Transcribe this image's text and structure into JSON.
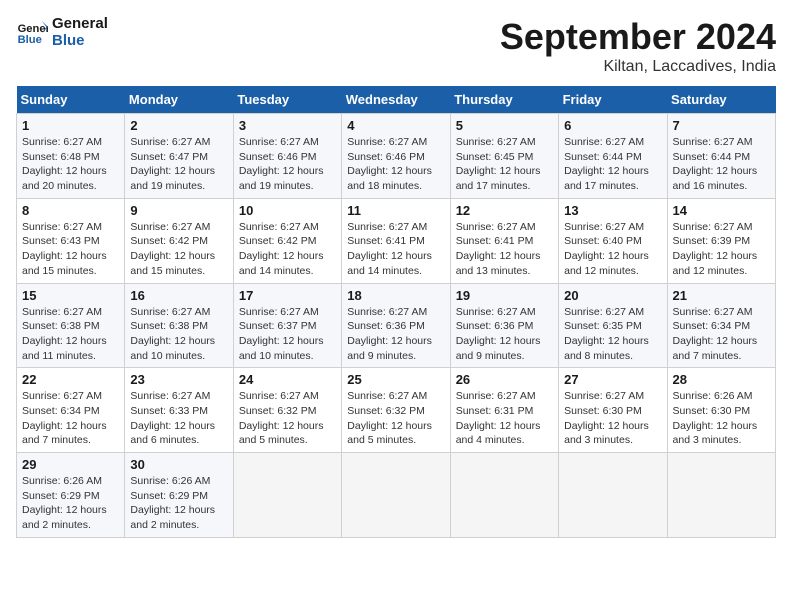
{
  "logo": {
    "line1": "General",
    "line2": "Blue"
  },
  "title": "September 2024",
  "subtitle": "Kiltan, Laccadives, India",
  "days_of_week": [
    "Sunday",
    "Monday",
    "Tuesday",
    "Wednesday",
    "Thursday",
    "Friday",
    "Saturday"
  ],
  "weeks": [
    [
      {
        "day": "1",
        "sunrise": "6:27 AM",
        "sunset": "6:48 PM",
        "daylight": "12 hours and 20 minutes."
      },
      {
        "day": "2",
        "sunrise": "6:27 AM",
        "sunset": "6:47 PM",
        "daylight": "12 hours and 19 minutes."
      },
      {
        "day": "3",
        "sunrise": "6:27 AM",
        "sunset": "6:46 PM",
        "daylight": "12 hours and 19 minutes."
      },
      {
        "day": "4",
        "sunrise": "6:27 AM",
        "sunset": "6:46 PM",
        "daylight": "12 hours and 18 minutes."
      },
      {
        "day": "5",
        "sunrise": "6:27 AM",
        "sunset": "6:45 PM",
        "daylight": "12 hours and 17 minutes."
      },
      {
        "day": "6",
        "sunrise": "6:27 AM",
        "sunset": "6:44 PM",
        "daylight": "12 hours and 17 minutes."
      },
      {
        "day": "7",
        "sunrise": "6:27 AM",
        "sunset": "6:44 PM",
        "daylight": "12 hours and 16 minutes."
      }
    ],
    [
      {
        "day": "8",
        "sunrise": "6:27 AM",
        "sunset": "6:43 PM",
        "daylight": "12 hours and 15 minutes."
      },
      {
        "day": "9",
        "sunrise": "6:27 AM",
        "sunset": "6:42 PM",
        "daylight": "12 hours and 15 minutes."
      },
      {
        "day": "10",
        "sunrise": "6:27 AM",
        "sunset": "6:42 PM",
        "daylight": "12 hours and 14 minutes."
      },
      {
        "day": "11",
        "sunrise": "6:27 AM",
        "sunset": "6:41 PM",
        "daylight": "12 hours and 14 minutes."
      },
      {
        "day": "12",
        "sunrise": "6:27 AM",
        "sunset": "6:41 PM",
        "daylight": "12 hours and 13 minutes."
      },
      {
        "day": "13",
        "sunrise": "6:27 AM",
        "sunset": "6:40 PM",
        "daylight": "12 hours and 12 minutes."
      },
      {
        "day": "14",
        "sunrise": "6:27 AM",
        "sunset": "6:39 PM",
        "daylight": "12 hours and 12 minutes."
      }
    ],
    [
      {
        "day": "15",
        "sunrise": "6:27 AM",
        "sunset": "6:38 PM",
        "daylight": "12 hours and 11 minutes."
      },
      {
        "day": "16",
        "sunrise": "6:27 AM",
        "sunset": "6:38 PM",
        "daylight": "12 hours and 10 minutes."
      },
      {
        "day": "17",
        "sunrise": "6:27 AM",
        "sunset": "6:37 PM",
        "daylight": "12 hours and 10 minutes."
      },
      {
        "day": "18",
        "sunrise": "6:27 AM",
        "sunset": "6:36 PM",
        "daylight": "12 hours and 9 minutes."
      },
      {
        "day": "19",
        "sunrise": "6:27 AM",
        "sunset": "6:36 PM",
        "daylight": "12 hours and 9 minutes."
      },
      {
        "day": "20",
        "sunrise": "6:27 AM",
        "sunset": "6:35 PM",
        "daylight": "12 hours and 8 minutes."
      },
      {
        "day": "21",
        "sunrise": "6:27 AM",
        "sunset": "6:34 PM",
        "daylight": "12 hours and 7 minutes."
      }
    ],
    [
      {
        "day": "22",
        "sunrise": "6:27 AM",
        "sunset": "6:34 PM",
        "daylight": "12 hours and 7 minutes."
      },
      {
        "day": "23",
        "sunrise": "6:27 AM",
        "sunset": "6:33 PM",
        "daylight": "12 hours and 6 minutes."
      },
      {
        "day": "24",
        "sunrise": "6:27 AM",
        "sunset": "6:32 PM",
        "daylight": "12 hours and 5 minutes."
      },
      {
        "day": "25",
        "sunrise": "6:27 AM",
        "sunset": "6:32 PM",
        "daylight": "12 hours and 5 minutes."
      },
      {
        "day": "26",
        "sunrise": "6:27 AM",
        "sunset": "6:31 PM",
        "daylight": "12 hours and 4 minutes."
      },
      {
        "day": "27",
        "sunrise": "6:27 AM",
        "sunset": "6:30 PM",
        "daylight": "12 hours and 3 minutes."
      },
      {
        "day": "28",
        "sunrise": "6:26 AM",
        "sunset": "6:30 PM",
        "daylight": "12 hours and 3 minutes."
      }
    ],
    [
      {
        "day": "29",
        "sunrise": "6:26 AM",
        "sunset": "6:29 PM",
        "daylight": "12 hours and 2 minutes."
      },
      {
        "day": "30",
        "sunrise": "6:26 AM",
        "sunset": "6:29 PM",
        "daylight": "12 hours and 2 minutes."
      },
      null,
      null,
      null,
      null,
      null
    ]
  ]
}
